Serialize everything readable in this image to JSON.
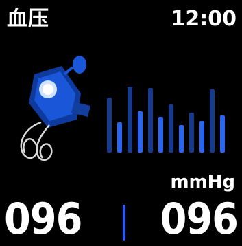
{
  "header": {
    "title": "血压",
    "time": "12:00"
  },
  "measurement": {
    "unit": "mmHg",
    "systolic": "096",
    "diastolic": "096"
  },
  "icons": {
    "monitor": "blood-pressure-monitor-icon",
    "chart": "pressure-history-chart"
  },
  "colors": {
    "accent": "#1c5fff",
    "bar": "#2a6cff",
    "background": "#000000"
  }
}
